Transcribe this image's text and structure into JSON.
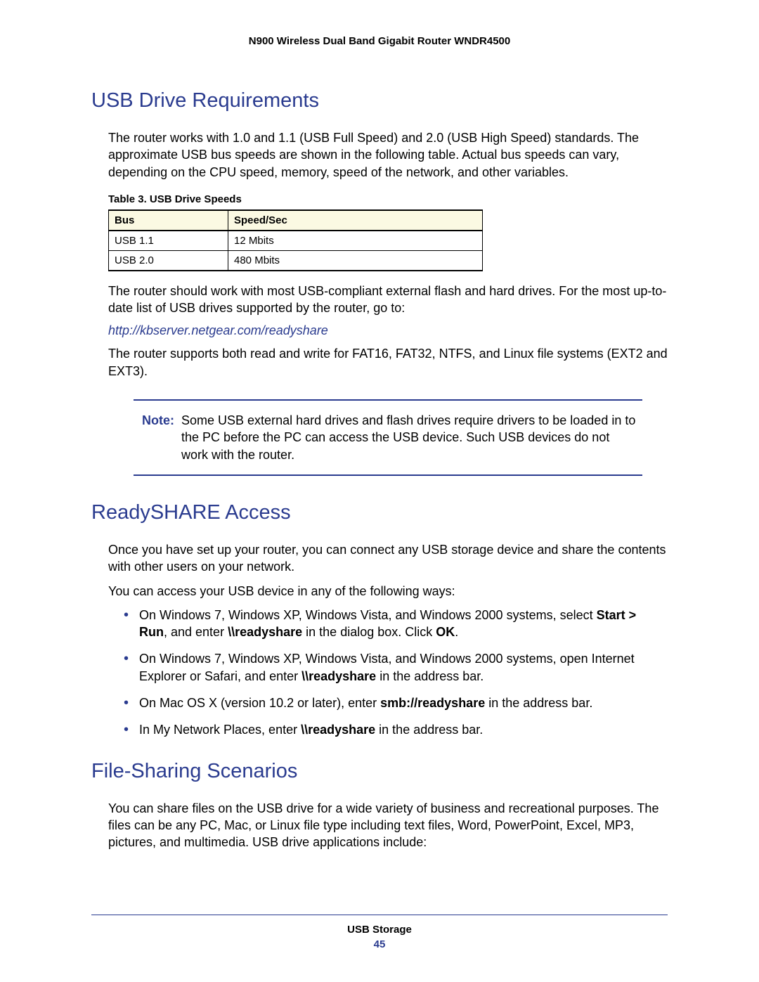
{
  "header": {
    "product": "N900 Wireless Dual Band Gigabit Router WNDR4500"
  },
  "section1": {
    "title": "USB Drive Requirements",
    "p1": "The router works with 1.0 and 1.1 (USB Full Speed) and 2.0 (USB High Speed) standards. The approximate USB bus speeds are shown in the following table. Actual bus speeds can vary, depending on the CPU speed, memory, speed of the network, and other variables.",
    "table_caption": "Table 3.  USB Drive Speeds",
    "table": {
      "col1": "Bus",
      "col2": "Speed/Sec",
      "rows": [
        {
          "bus": "USB 1.1",
          "speed": "12 Mbits"
        },
        {
          "bus": "USB 2.0",
          "speed": "480 Mbits"
        }
      ]
    },
    "p2": "The router should work with most USB-compliant external flash and hard drives. For the most up-to-date list of USB drives supported by the router, go to:",
    "link": "http://kbserver.netgear.com/readyshare",
    "p3": "The router supports both read and write for FAT16, FAT32, NTFS, and Linux file systems (EXT2 and EXT3).",
    "note_label": "Note:",
    "note_body": "Some USB external hard drives and flash drives require drivers to be loaded in to the PC before the PC can access the USB device. Such USB devices do not work with the router."
  },
  "section2": {
    "title": "ReadySHARE Access",
    "p1": "Once you have set up your router, you can connect any USB storage device and share the contents with other users on your network.",
    "p2": "You can access your USB device in any of the following ways:",
    "bullets": {
      "b1a": "On Windows 7, Windows XP, Windows Vista, and Windows 2000 systems, select ",
      "b1b": "Start > Run",
      "b1c": ", and enter ",
      "b1d": "\\\\readyshare",
      "b1e": " in the dialog box. Click ",
      "b1f": "OK",
      "b1g": ".",
      "b2a": "On Windows 7, Windows XP, Windows Vista, and Windows 2000 systems, open Internet Explorer or Safari, and enter ",
      "b2b": "\\\\readyshare",
      "b2c": " in the address bar.",
      "b3a": "On Mac OS X (version 10.2 or later), enter ",
      "b3b": "smb://readyshare",
      "b3c": " in the address bar.",
      "b4a": "In My Network Places, enter ",
      "b4b": "\\\\readyshare",
      "b4c": " in the address bar."
    }
  },
  "section3": {
    "title": "File-Sharing Scenarios",
    "p1": "You can share files on the USB drive for a wide variety of business and recreational purposes. The files can be any PC, Mac, or Linux file type including text files, Word, PowerPoint, Excel, MP3, pictures, and multimedia. USB drive applications include:"
  },
  "footer": {
    "chapter": "USB Storage",
    "page": "45"
  }
}
